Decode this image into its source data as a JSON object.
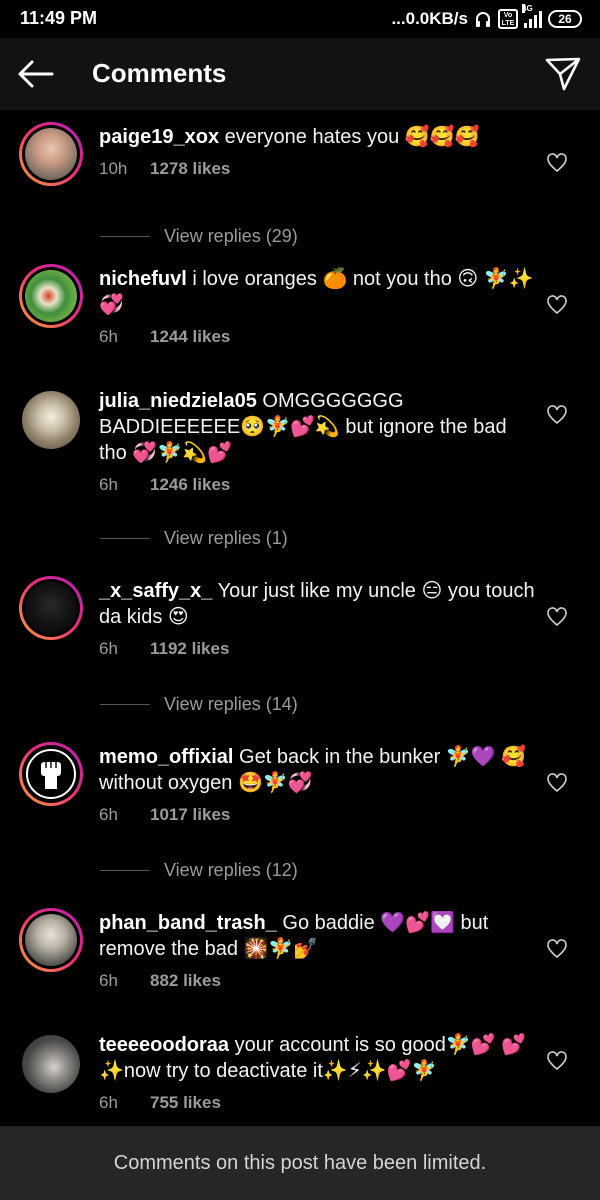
{
  "status_bar": {
    "time": "11:49 PM",
    "speed": "...0.0KB/s",
    "volte_label": "Vo LTE",
    "network": "4G",
    "battery": "26"
  },
  "header": {
    "title": "Comments",
    "back_icon": "arrow-left-icon",
    "share_icon": "paper-plane-icon"
  },
  "comments": [
    {
      "username": "paige19_xox",
      "text": "everyone hates you 🥰🥰🥰",
      "time": "10h",
      "likes": "1278 likes",
      "story_ring": true,
      "replies": "View replies (29)"
    },
    {
      "username": "nichefuvl",
      "text": "i love oranges 🍊 not you tho 🙃 🧚✨💞",
      "time": "6h",
      "likes": "1244 likes",
      "story_ring": true,
      "replies": ""
    },
    {
      "username": "julia_niedziela05",
      "text": "OMGGGGGGG BADDIEEEEEE🥺🧚💕💫 but ignore the bad tho 💞🧚💫💕",
      "time": "6h",
      "likes": "1246 likes",
      "story_ring": false,
      "replies": "View replies (1)"
    },
    {
      "username": "_x_saffy_x_",
      "text": "Your just like my uncle 😑 you touch da kids 😍",
      "time": "6h",
      "likes": "1192 likes",
      "story_ring": true,
      "replies": "View replies (14)"
    },
    {
      "username": "memo_offixial",
      "text": "Get back in the bunker 🧚💜 🥰 without oxygen 🤩🧚💞",
      "time": "6h",
      "likes": "1017 likes",
      "story_ring": true,
      "replies": "View replies (12)"
    },
    {
      "username": "phan_band_trash_",
      "text": "Go baddie 💜💕💟 but remove the bad 🎇🧚💅",
      "time": "6h",
      "likes": "882 likes",
      "story_ring": true,
      "replies": ""
    },
    {
      "username": "teeeeoodoraa",
      "text": "your account is so good🧚💕 💕✨now try to deactivate it✨⚡✨💕🧚",
      "time": "6h",
      "likes": "755 likes",
      "story_ring": false,
      "replies": ""
    }
  ],
  "footer": {
    "text": "Comments on this post have been limited."
  },
  "colors": {
    "background": "#000000",
    "header_bg": "#121212",
    "footer_bg": "#262626",
    "muted_text": "#9b9b9b",
    "ring_start": "#f9a23b",
    "ring_end": "#b21fbf"
  }
}
